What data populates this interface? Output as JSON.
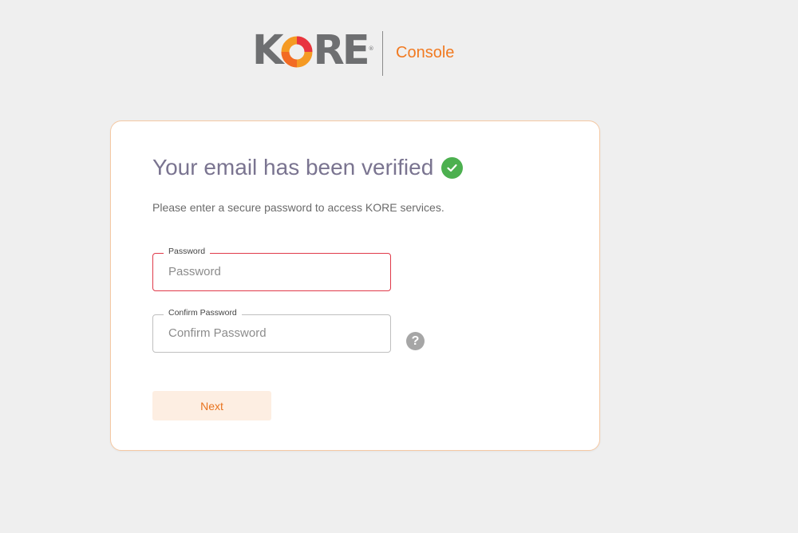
{
  "brand": {
    "logo_text_k": "K",
    "logo_text_re": "RE",
    "registered_mark": "®",
    "product_name": "Console",
    "colors": {
      "logo_gray": "#6e6f71",
      "accent_orange": "#f17a21",
      "logo_red": "#e8343f"
    }
  },
  "card": {
    "title": "Your email has been verified",
    "subtitle": "Please enter a secure password to access KORE services.",
    "password": {
      "label": "Password",
      "placeholder": "Password",
      "state": "error"
    },
    "confirm_password": {
      "label": "Confirm Password",
      "placeholder": "Confirm Password"
    },
    "help_icon": "question-circle-icon",
    "help_glyph": "?",
    "next_label": "Next",
    "colors": {
      "success": "#4cb04f",
      "error_border": "#e03a4a",
      "button_bg": "#fdeee2"
    }
  }
}
